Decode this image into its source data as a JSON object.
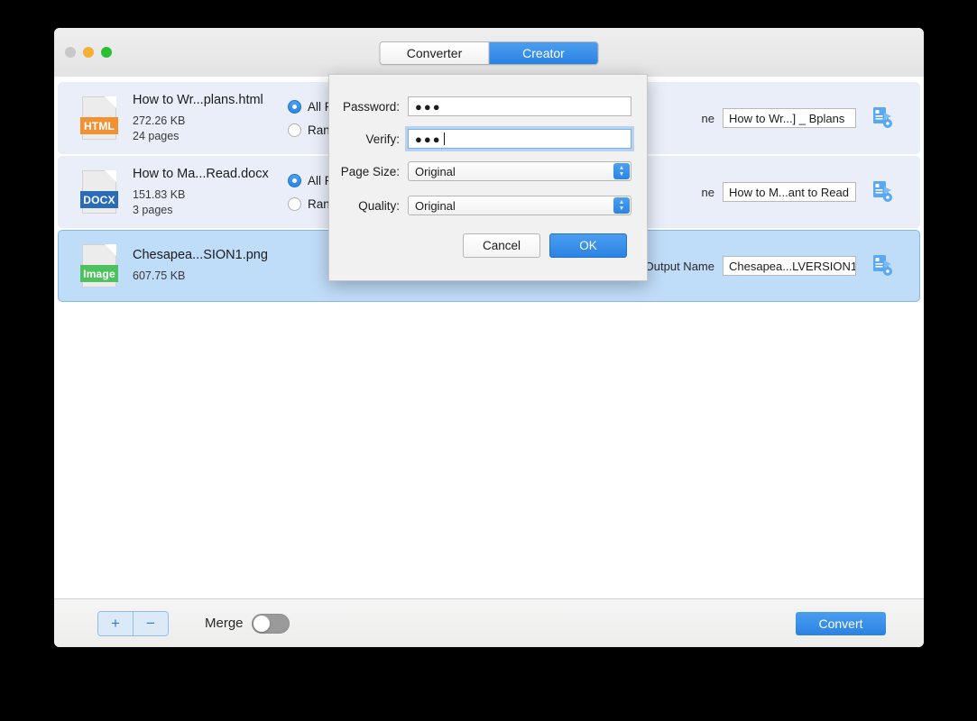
{
  "window": {
    "traffic_lights": [
      "close",
      "minimize",
      "zoom"
    ],
    "tabs": [
      {
        "label": "Converter",
        "active": false
      },
      {
        "label": "Creator",
        "active": true
      }
    ]
  },
  "files": [
    {
      "icon_label": "HTML",
      "icon_color": "#f09234",
      "name": "How to Wr...plans.html",
      "size": "272.26 KB",
      "pages": "24 pages",
      "all_pages_label": "All Pag",
      "range_label": "Range",
      "all_pages_selected": true,
      "output_label": "ne",
      "output_name": "How to Wr...] _ Bplans",
      "settings_icon": "document-settings-icon",
      "selected": false
    },
    {
      "icon_label": "DOCX",
      "icon_color": "#2b6cb8",
      "name": "How to Ma...Read.docx",
      "size": "151.83 KB",
      "pages": "3 pages",
      "all_pages_label": "All Pag",
      "range_label": "Range",
      "all_pages_selected": true,
      "output_label": "ne",
      "output_name": "How to M...ant to Read",
      "settings_icon": "document-settings-icon",
      "selected": false
    },
    {
      "icon_label": "Image",
      "icon_color": "#4cc15e",
      "name": "Chesapea...SION1.png",
      "size": "607.75 KB",
      "pages": "",
      "all_pages_label": "",
      "range_label": "",
      "all_pages_selected": false,
      "output_label": "Output Name",
      "output_name": "Chesapea...LVERSION1",
      "settings_icon": "document-settings-icon",
      "selected": true
    }
  ],
  "toolbar": {
    "add_label": "+",
    "remove_label": "−",
    "merge_label": "Merge",
    "merge_on": false,
    "convert_label": "Convert"
  },
  "dialog": {
    "password_label": "Password:",
    "password_value": "●●●",
    "verify_label": "Verify:",
    "verify_value": "●●●",
    "verify_focused": true,
    "page_size_label": "Page Size:",
    "page_size_value": "Original",
    "quality_label": "Quality:",
    "quality_value": "Original",
    "cancel_label": "Cancel",
    "ok_label": "OK"
  },
  "colors": {
    "accent_blue": "#2b83e2",
    "selected_row": "#bfdcf8",
    "row_bg": "#e9eef8",
    "focus_ring": "#76b0e8"
  }
}
